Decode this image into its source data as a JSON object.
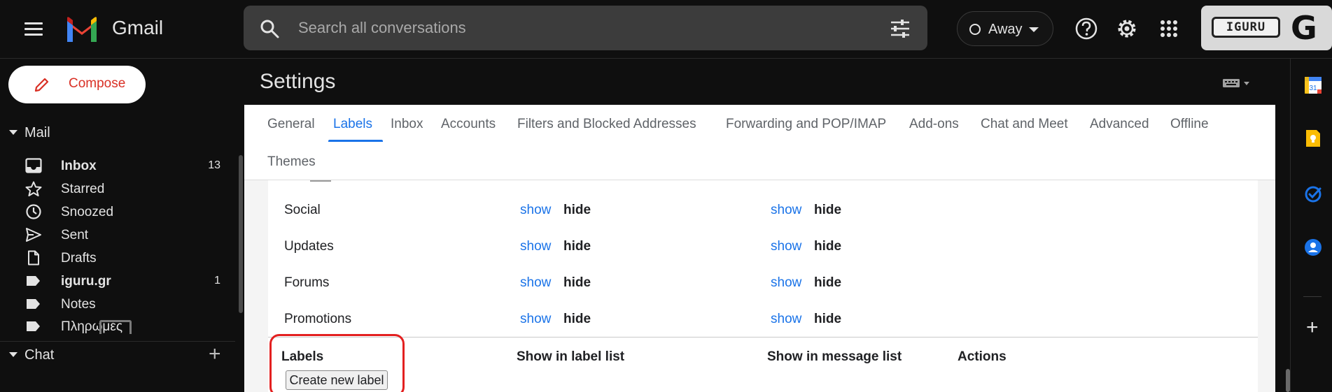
{
  "header": {
    "brand": "Gmail",
    "search_placeholder": "Search all conversations",
    "status": "Away",
    "account_watermark": "IGURU",
    "account_initial": "G",
    "icons": [
      "menu-icon",
      "gmail-logo",
      "search-icon",
      "tune-icon",
      "help-icon",
      "settings-gear-icon",
      "apps-grid-icon"
    ]
  },
  "sidebar": {
    "compose_label": "Compose",
    "mail_section": "Mail",
    "items": [
      {
        "label": "Inbox",
        "count": "13",
        "bold": true,
        "icon": "inbox-icon"
      },
      {
        "label": "Starred",
        "count": "",
        "bold": false,
        "icon": "star-icon"
      },
      {
        "label": "Snoozed",
        "count": "",
        "bold": false,
        "icon": "clock-icon"
      },
      {
        "label": "Sent",
        "count": "",
        "bold": false,
        "icon": "send-icon"
      },
      {
        "label": "Drafts",
        "count": "",
        "bold": false,
        "icon": "draft-icon"
      },
      {
        "label": "iguru.gr",
        "count": "1",
        "bold": true,
        "icon": "label-icon"
      },
      {
        "label": "Notes",
        "count": "",
        "bold": false,
        "icon": "label-icon"
      },
      {
        "label": "Πληρωμές",
        "count": "",
        "bold": false,
        "icon": "label-icon"
      }
    ],
    "chat_section": "Chat"
  },
  "settings": {
    "title": "Settings",
    "tabs": [
      "General",
      "Labels",
      "Inbox",
      "Accounts",
      "Filters and Blocked Addresses",
      "Forwarding and POP/IMAP",
      "Add-ons",
      "Chat and Meet",
      "Advanced",
      "Offline",
      "Themes"
    ],
    "active_tab": "Labels",
    "category_rows": [
      {
        "name": "Social",
        "show": "show",
        "hide": "hide"
      },
      {
        "name": "Updates",
        "show": "show",
        "hide": "hide"
      },
      {
        "name": "Forums",
        "show": "show",
        "hide": "hide"
      },
      {
        "name": "Promotions",
        "show": "show",
        "hide": "hide"
      }
    ],
    "labels_header": {
      "labels": "Labels",
      "show_in_label_list": "Show in label list",
      "show_in_message_list": "Show in message list",
      "actions": "Actions"
    },
    "create_button": "Create new label"
  },
  "right_rail": {
    "icons": [
      "calendar-icon",
      "keep-icon",
      "tasks-icon",
      "contacts-icon",
      "add-icon"
    ],
    "calendar_day": "31"
  },
  "colors": {
    "accent": "#1a73e8",
    "compose_text": "#d93025",
    "highlight": "#e32020",
    "dark_bg": "#0f0f0f"
  }
}
